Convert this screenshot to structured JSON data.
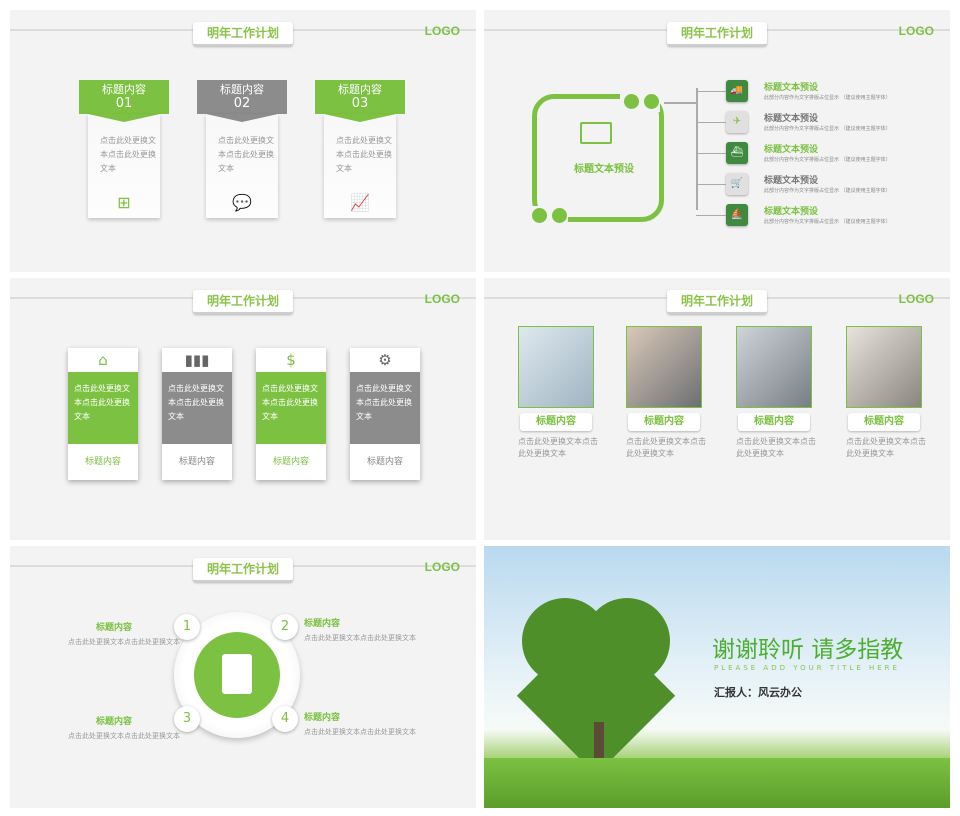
{
  "common": {
    "title": "明年工作计划",
    "logo": "LOGO"
  },
  "slide1": {
    "cards": [
      {
        "label": "标题内容",
        "num": "01",
        "text": "点击此处更换文本点击此处更换文本",
        "color": "#7cc142",
        "icon": "windows-icon",
        "glyph": "⊞"
      },
      {
        "label": "标题内容",
        "num": "02",
        "text": "点击此处更换文本点击此处更换文本",
        "color": "#8c8c8c",
        "icon": "chat-icon",
        "glyph": "💬"
      },
      {
        "label": "标题内容",
        "num": "03",
        "text": "点击此处更换文本点击此处更换文本",
        "color": "#7cc142",
        "icon": "chart-up-icon",
        "glyph": "📈"
      }
    ]
  },
  "slide2": {
    "center_label": "标题文本预设",
    "rows": [
      {
        "title": "标题文本预设",
        "sub": "此部分内容作为文字排版占位显示 （建议使用主题字体）",
        "dark": true,
        "icon": "truck-icon",
        "glyph": "🚚"
      },
      {
        "title": "标题文本预设",
        "sub": "此部分内容作为文字排版占位显示 （建议使用主题字体）",
        "dark": false,
        "icon": "plane-icon",
        "glyph": "✈"
      },
      {
        "title": "标题文本预设",
        "sub": "此部分内容作为文字排版占位显示 （建议使用主题字体）",
        "dark": true,
        "icon": "ship-icon",
        "glyph": "⛴"
      },
      {
        "title": "标题文本预设",
        "sub": "此部分内容作为文字排版占位显示 （建议使用主题字体）",
        "dark": false,
        "icon": "cart-icon",
        "glyph": "🛒"
      },
      {
        "title": "标题文本预设",
        "sub": "此部分内容作为文字排版占位显示 （建议使用主题字体）",
        "dark": true,
        "icon": "boat-icon",
        "glyph": "⛵"
      }
    ]
  },
  "slide3": {
    "cards": [
      {
        "text": "点击此处更换文本点击此处更换文本",
        "label": "标题内容",
        "green": true,
        "icon": "home-icon",
        "glyph": "⌂"
      },
      {
        "text": "点击此处更换文本点击此处更换文本",
        "label": "标题内容",
        "green": false,
        "icon": "bar-chart-icon",
        "glyph": "▮▮▮"
      },
      {
        "text": "点击此处更换文本点击此处更换文本",
        "label": "标题内容",
        "green": true,
        "icon": "money-icon",
        "glyph": "$"
      },
      {
        "text": "点击此处更换文本点击此处更换文本",
        "label": "标题内容",
        "green": false,
        "icon": "gears-icon",
        "glyph": "⚙"
      }
    ]
  },
  "slide4": {
    "items": [
      {
        "label": "标题内容",
        "text": "点击此处更换文本点击此处更换文本",
        "photo": "document-photo"
      },
      {
        "label": "标题内容",
        "text": "点击此处更换文本点击此处更换文本",
        "photo": "laptop-photo"
      },
      {
        "label": "标题内容",
        "text": "点击此处更换文本点击此处更换文本",
        "photo": "keyboard-photo"
      },
      {
        "label": "标题内容",
        "text": "点击此处更换文本点击此处更换文本",
        "photo": "chess-photo"
      }
    ]
  },
  "slide5": {
    "items": [
      {
        "num": "1",
        "label": "标题内容",
        "text": "点击此处更换文本点击此处更换文本"
      },
      {
        "num": "2",
        "label": "标题内容",
        "text": "点击此处更换文本点击此处更换文本"
      },
      {
        "num": "3",
        "label": "标题内容",
        "text": "点击此处更换文本点击此处更换文本"
      },
      {
        "num": "4",
        "label": "标题内容",
        "text": "点击此处更换文本点击此处更换文本"
      }
    ]
  },
  "slide6": {
    "thanks": "谢谢聆听 请多指教",
    "english": "PLEASE ADD YOUR TITLE HERE",
    "reporter": "汇报人：风云办公"
  }
}
